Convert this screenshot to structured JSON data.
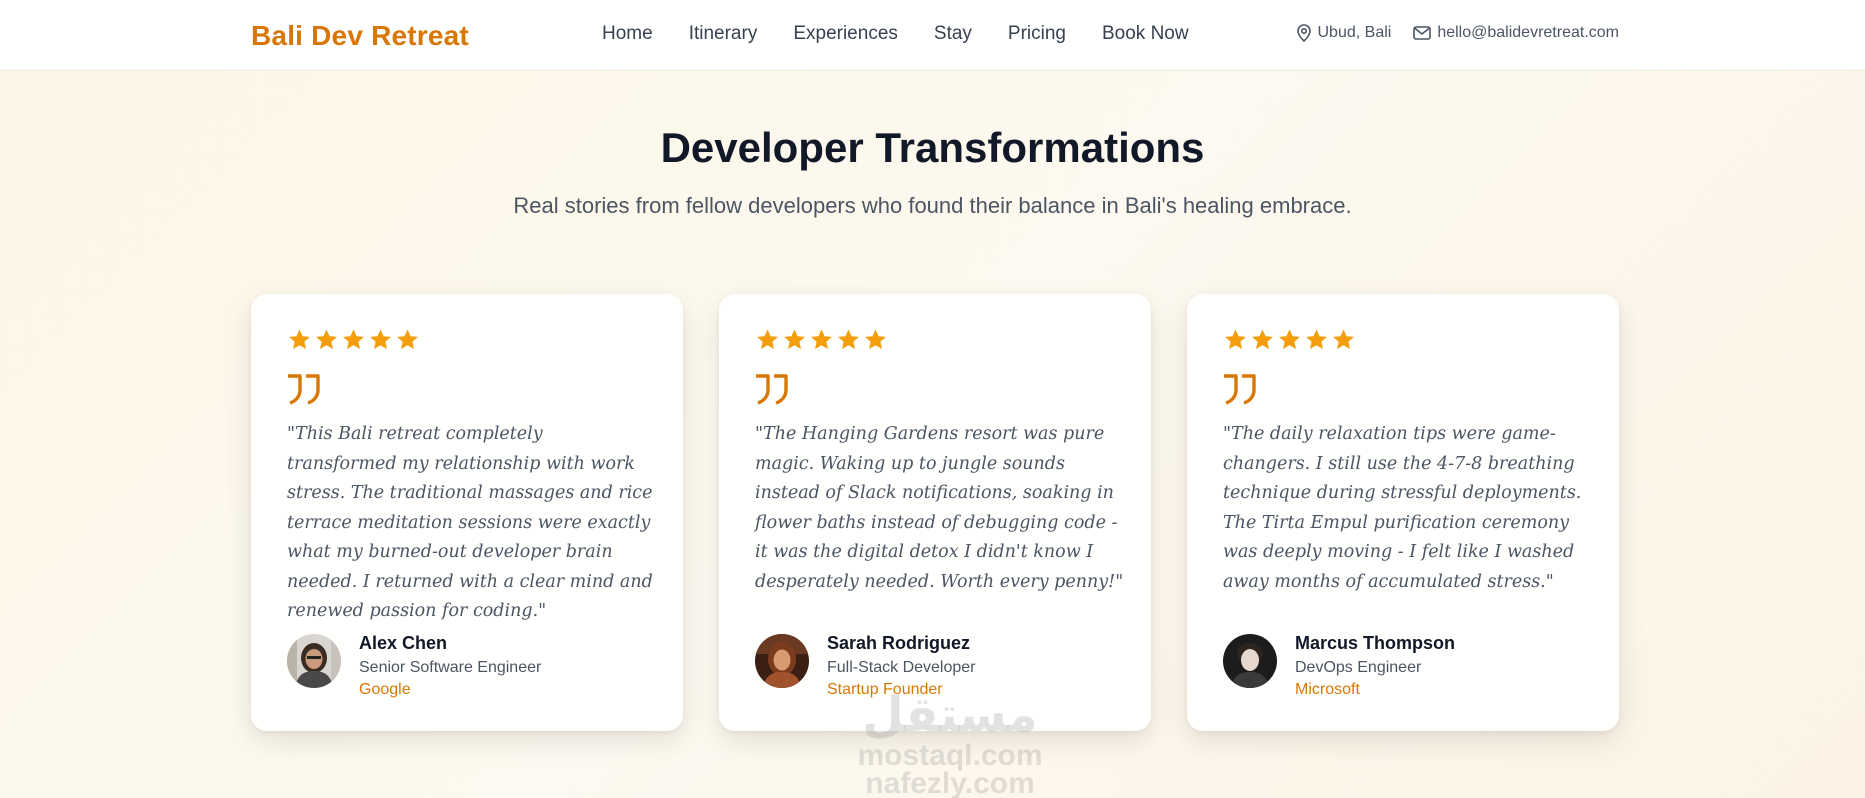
{
  "header": {
    "brand": "Bali Dev Retreat",
    "nav": [
      "Home",
      "Itinerary",
      "Experiences",
      "Stay",
      "Pricing",
      "Book Now"
    ],
    "location": "Ubud, Bali",
    "email": "hello@balidevretreat.com",
    "location_icon": "map-pin-icon",
    "email_icon": "mail-icon"
  },
  "section": {
    "title": "Developer Transformations",
    "subtitle": "Real stories from fellow developers who found their balance in Bali's healing embrace."
  },
  "testimonials": [
    {
      "rating": 5,
      "quote": "\"This Bali retreat completely transformed my relationship with work stress. The traditional massages and rice terrace meditation sessions were exactly what my burned-out developer brain needed. I returned with a clear mind and renewed passion for coding.\"",
      "name": "Alex Chen",
      "role": "Senior Software Engineer",
      "company": "Google"
    },
    {
      "rating": 5,
      "quote": "\"The Hanging Gardens resort was pure magic. Waking up to jungle sounds instead of Slack notifications, soaking in flower baths instead of debugging code - it was the digital detox I didn't know I desperately needed. Worth every penny!\"",
      "name": "Sarah Rodriguez",
      "role": "Full-Stack Developer",
      "company": "Startup Founder"
    },
    {
      "rating": 5,
      "quote": "\"The daily relaxation tips were game-changers. I still use the 4-7-8 breathing technique during stressful deployments. The Tirta Empul purification ceremony was deeply moving - I felt like I washed away months of accumulated stress.\"",
      "name": "Marcus Thompson",
      "role": "DevOps Engineer",
      "company": "Microsoft"
    }
  ],
  "watermark": {
    "logo": "مستقل",
    "lines": [
      "mostaql.com",
      "nafezly.com"
    ]
  },
  "colors": {
    "accent": "#d97706",
    "star": "#f59e0b",
    "quote_mark": "#d97706"
  }
}
